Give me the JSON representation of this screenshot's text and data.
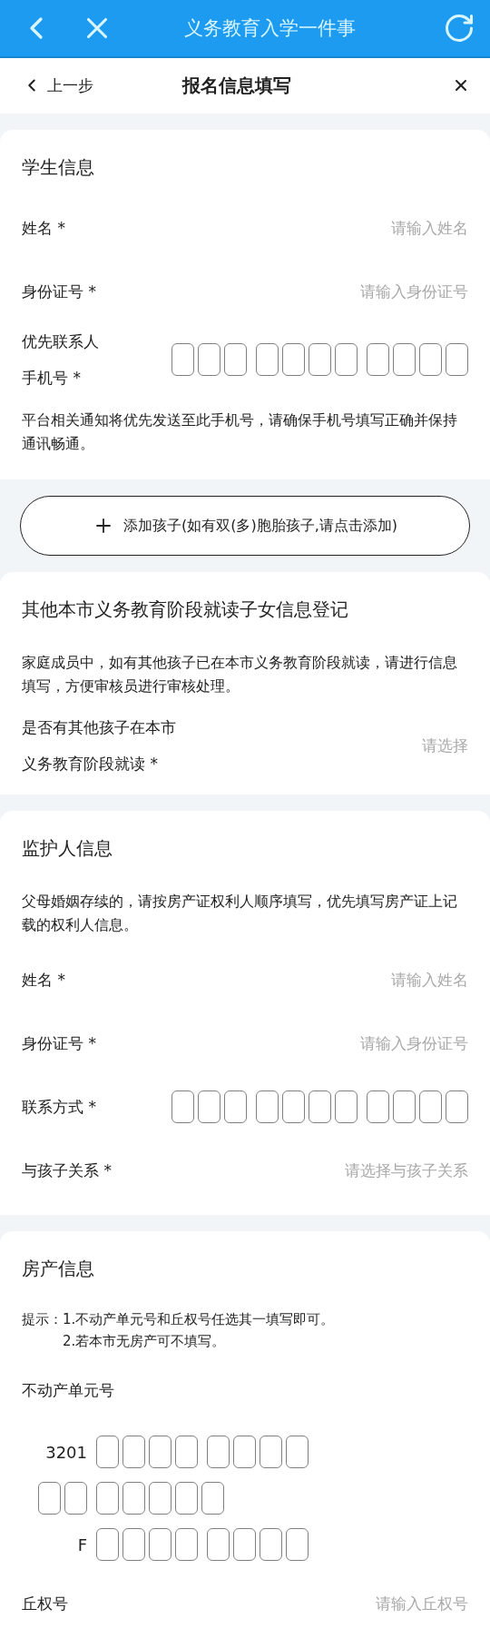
{
  "app_bar": {
    "title": "义务教育入学一件事"
  },
  "nav": {
    "back": "上一步",
    "title": "报名信息填写"
  },
  "sections": [
    {
      "kind": "card",
      "title": "学生信息",
      "fields": [
        {
          "kind": "input",
          "label": "姓名 *",
          "placeholder": "请输入姓名"
        },
        {
          "kind": "input",
          "label": "身份证号 *",
          "placeholder": "请输入身份证号"
        },
        {
          "kind": "digits",
          "label": "优先联系人手机号 *",
          "groups": [
            [
              {
                "kind": "box"
              },
              {
                "kind": "box"
              },
              {
                "kind": "box"
              }
            ],
            [
              {
                "kind": "box"
              },
              {
                "kind": "box"
              },
              {
                "kind": "box"
              },
              {
                "kind": "box"
              }
            ],
            [
              {
                "kind": "box"
              },
              {
                "kind": "box"
              },
              {
                "kind": "box"
              },
              {
                "kind": "box"
              }
            ]
          ]
        },
        {
          "kind": "note",
          "text": "平台相关通知将优先发送至此手机号，请确保手机号填写正确并保持通讯畅通。"
        }
      ]
    },
    {
      "kind": "button",
      "label": "添加孩子(如有双(多)胞胎孩子,请点击添加)"
    },
    {
      "kind": "card",
      "title": "其他本市义务教育阶段就读子女信息登记",
      "fields": [
        {
          "kind": "note",
          "text": "家庭成员中，如有其他孩子已在本市义务教育阶段就读，请进行信息填写，方便审核员进行审核处理。"
        },
        {
          "kind": "select",
          "label": "是否有其他孩子在本市义务教育阶段就读 *",
          "placeholder": "请选择"
        }
      ]
    },
    {
      "kind": "card",
      "title": "监护人信息",
      "fields": [
        {
          "kind": "note",
          "text": "父母婚姻存续的，请按房产证权利人顺序填写，优先填写房产证上记载的权利人信息。"
        },
        {
          "kind": "input",
          "label": "姓名 *",
          "placeholder": "请输入姓名"
        },
        {
          "kind": "input",
          "label": "身份证号 *",
          "placeholder": "请输入身份证号"
        },
        {
          "kind": "digits",
          "label": "联系方式 *",
          "groups": [
            [
              {
                "kind": "box"
              },
              {
                "kind": "box"
              },
              {
                "kind": "box"
              }
            ],
            [
              {
                "kind": "box"
              },
              {
                "kind": "box"
              },
              {
                "kind": "box"
              },
              {
                "kind": "box"
              }
            ],
            [
              {
                "kind": "box"
              },
              {
                "kind": "box"
              },
              {
                "kind": "box"
              },
              {
                "kind": "box"
              }
            ]
          ]
        },
        {
          "kind": "select",
          "label": "与孩子关系 *",
          "placeholder": "请选择与孩子关系"
        }
      ]
    },
    {
      "kind": "card",
      "title": "房产信息",
      "fields": [
        {
          "kind": "tip",
          "label": "提示：",
          "items": [
            "1.不动产单元号和丘权号任选其一填写即可。",
            "2.若本市无房产可不填写。"
          ]
        },
        {
          "kind": "code",
          "label": "不动产单元号",
          "rows": [
            {
              "lead": {
                "kind": "text",
                "text": "3201"
              },
              "groups": [
                [
                  {
                    "kind": "box"
                  },
                  {
                    "kind": "box"
                  },
                  {
                    "kind": "box"
                  },
                  {
                    "kind": "box"
                  }
                ],
                [
                  {
                    "kind": "box"
                  },
                  {
                    "kind": "box"
                  },
                  {
                    "kind": "box"
                  },
                  {
                    "kind": "box"
                  }
                ]
              ]
            },
            {
              "lead": {
                "kind": "boxes",
                "cells": [
                  {
                    "kind": "box"
                  },
                  {
                    "kind": "box"
                  }
                ]
              },
              "groups": [
                [
                  {
                    "kind": "box"
                  },
                  {
                    "kind": "box"
                  },
                  {
                    "kind": "box"
                  },
                  {
                    "kind": "box"
                  },
                  {
                    "kind": "box"
                  }
                ]
              ]
            },
            {
              "lead": {
                "kind": "text",
                "text": "F"
              },
              "groups": [
                [
                  {
                    "kind": "box"
                  },
                  {
                    "kind": "box"
                  },
                  {
                    "kind": "box"
                  },
                  {
                    "kind": "box"
                  }
                ],
                [
                  {
                    "kind": "box"
                  },
                  {
                    "kind": "box"
                  },
                  {
                    "kind": "box"
                  },
                  {
                    "kind": "box"
                  }
                ]
              ]
            }
          ]
        },
        {
          "kind": "input",
          "label": "丘权号",
          "placeholder": "请输入丘权号"
        }
      ]
    }
  ]
}
